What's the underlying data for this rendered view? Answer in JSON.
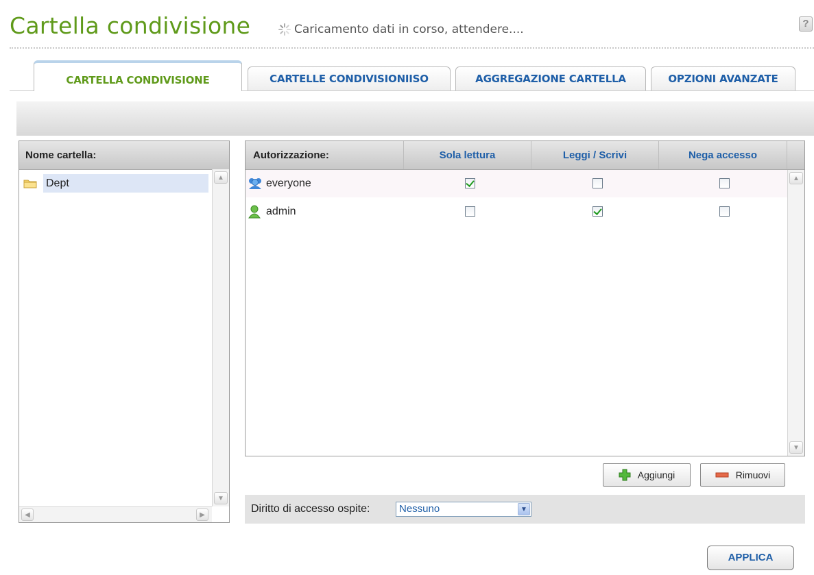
{
  "page": {
    "title": "Cartella condivisione",
    "loading_text": "Caricamento dati in corso, attendere....",
    "help_icon": "?"
  },
  "tabs": [
    {
      "label": "CARTELLA CONDIVISIONE",
      "active": true
    },
    {
      "label": "CARTELLE CONDIVISIONIISO",
      "active": false
    },
    {
      "label": "AGGREGAZIONE CARTELLA",
      "active": false
    },
    {
      "label": "OPZIONI AVANZATE",
      "active": false
    }
  ],
  "folder_panel": {
    "header": "Nome cartella:",
    "folders": [
      {
        "name": "Dept",
        "selected": true,
        "icon": "folder-icon"
      }
    ]
  },
  "permissions": {
    "headers": {
      "authorization": "Autorizzazione:",
      "read_only": "Sola lettura",
      "read_write": "Leggi / Scrivi",
      "deny": "Nega accesso"
    },
    "rows": [
      {
        "name": "everyone",
        "icon": "group-icon",
        "read_only": true,
        "read_write": false,
        "deny": false
      },
      {
        "name": "admin",
        "icon": "user-icon",
        "read_only": false,
        "read_write": true,
        "deny": false
      }
    ],
    "add_label": "Aggiungi",
    "remove_label": "Rimuovi"
  },
  "guest": {
    "label": "Diritto di accesso ospite:",
    "value": "Nessuno"
  },
  "apply_label": "APPLICA",
  "colors": {
    "title_green": "#5f9a1a",
    "link_blue": "#1f5fa8",
    "selection": "#dde6f6"
  }
}
